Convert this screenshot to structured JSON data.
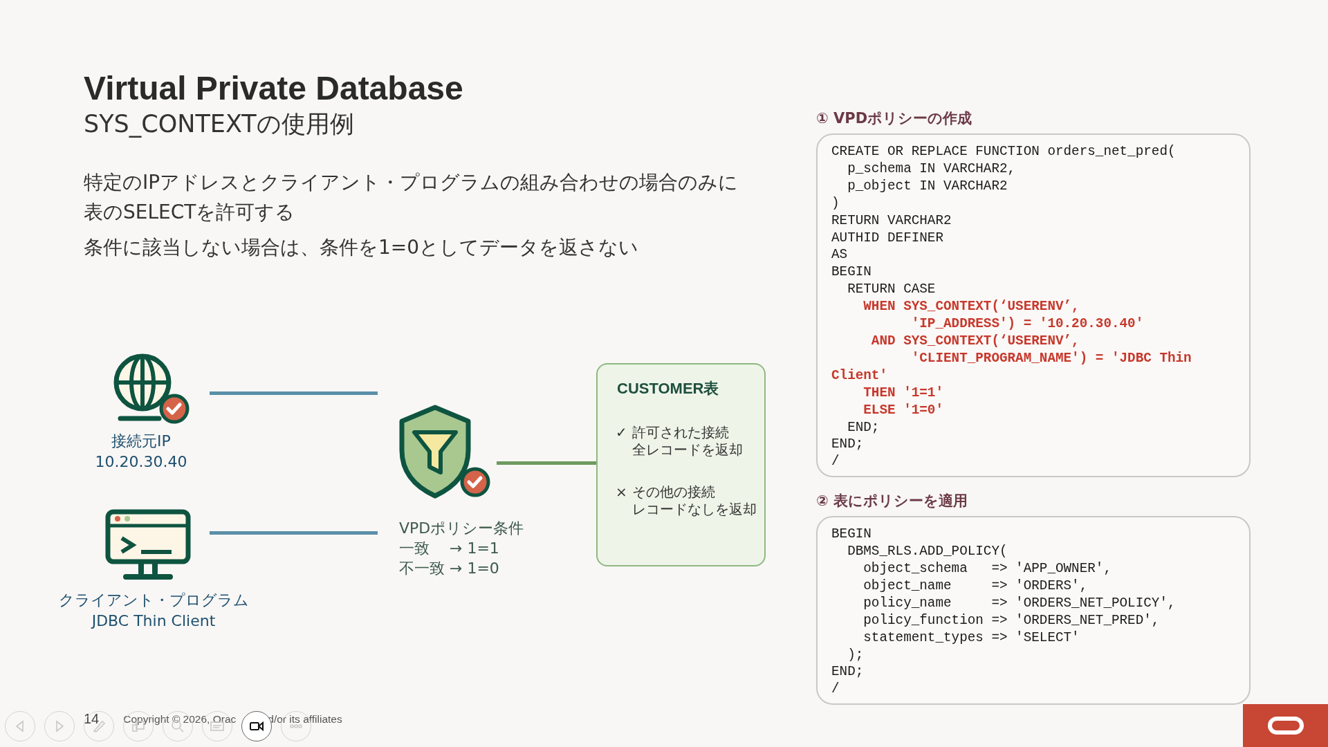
{
  "slide": {
    "title": "Virtual Private Database",
    "subtitle": "SYS_CONTEXTの使用例",
    "body": [
      "特定のIPアドレスとクライアント・プログラムの組み合わせの場合のみに表のSELECTを許可する",
      "条件に該当しない場合は、条件を1=0としてデータを返さない"
    ],
    "diagram": {
      "sources": [
        {
          "kind": "ip",
          "label": "接続元IP",
          "value": "10.20.30.40"
        },
        {
          "kind": "program",
          "label": "クライアント・プログラム",
          "value": "JDBC Thin Client"
        }
      ],
      "policy": {
        "title": "VPDポリシー条件",
        "rules": [
          "一致　 → 1=1",
          "不一致 → 1=0"
        ]
      },
      "table": {
        "title": "CUSTOMER表",
        "outcomes": [
          {
            "mark": "✓",
            "title": "許可された接続",
            "detail": "全レコードを返却"
          },
          {
            "mark": "×",
            "title": "その他の接続",
            "detail": "レコードなしを返却"
          }
        ]
      }
    },
    "code_panels": [
      {
        "heading": "① VPDポリシーの作成",
        "lines": [
          {
            "text": "CREATE OR REPLACE FUNCTION orders_net_pred(",
            "kind": "plain"
          },
          {
            "text": "  p_schema IN VARCHAR2,",
            "kind": "plain"
          },
          {
            "text": "  p_object IN VARCHAR2",
            "kind": "plain"
          },
          {
            "text": ")",
            "kind": "plain"
          },
          {
            "text": "RETURN VARCHAR2",
            "kind": "plain"
          },
          {
            "text": "AUTHID DEFINER",
            "kind": "plain"
          },
          {
            "text": "AS",
            "kind": "plain"
          },
          {
            "text": "BEGIN",
            "kind": "plain"
          },
          {
            "text": "  RETURN CASE",
            "kind": "plain"
          },
          {
            "text": "    WHEN SYS_CONTEXT(‘USERENV’,",
            "kind": "emphasis"
          },
          {
            "text": "          'IP_ADDRESS') = '10.20.30.40'",
            "kind": "emphasis"
          },
          {
            "text": "     AND SYS_CONTEXT(‘USERENV’,",
            "kind": "emphasis"
          },
          {
            "text": "          'CLIENT_PROGRAM_NAME') = 'JDBC Thin",
            "kind": "emphasis"
          },
          {
            "text": "Client'",
            "kind": "emphasis"
          },
          {
            "text": "    THEN '1=1'",
            "kind": "emphasis"
          },
          {
            "text": "    ELSE '1=0'",
            "kind": "emphasis"
          },
          {
            "text": "  END;",
            "kind": "plain"
          },
          {
            "text": "END;",
            "kind": "plain"
          },
          {
            "text": "/",
            "kind": "plain"
          }
        ]
      },
      {
        "heading": "② 表にポリシーを適用",
        "lines": [
          {
            "text": "BEGIN",
            "kind": "plain"
          },
          {
            "text": "  DBMS_RLS.ADD_POLICY(",
            "kind": "plain"
          },
          {
            "text": "    object_schema   => 'APP_OWNER',",
            "kind": "plain"
          },
          {
            "text": "    object_name     => 'ORDERS',",
            "kind": "plain"
          },
          {
            "text": "    policy_name     => 'ORDERS_NET_POLICY',",
            "kind": "plain"
          },
          {
            "text": "    policy_function => 'ORDERS_NET_PRED',",
            "kind": "plain"
          },
          {
            "text": "    statement_types => 'SELECT'",
            "kind": "plain"
          },
          {
            "text": "  );",
            "kind": "plain"
          },
          {
            "text": "END;",
            "kind": "plain"
          },
          {
            "text": "/",
            "kind": "plain"
          }
        ]
      }
    ],
    "page_number": "14",
    "copyright": [
      "Copyright © 2026, Orac",
      "d/or its affiliates"
    ]
  },
  "presenter_toolbar": {
    "buttons": [
      {
        "kind": "previous",
        "highlighted": false
      },
      {
        "kind": "next",
        "highlighted": false
      },
      {
        "kind": "pen",
        "highlighted": false
      },
      {
        "kind": "slides",
        "highlighted": false
      },
      {
        "kind": "zoom",
        "highlighted": false
      },
      {
        "kind": "subtitles",
        "highlighted": false
      },
      {
        "kind": "camera",
        "highlighted": true
      },
      {
        "kind": "more",
        "highlighted": false
      }
    ]
  }
}
